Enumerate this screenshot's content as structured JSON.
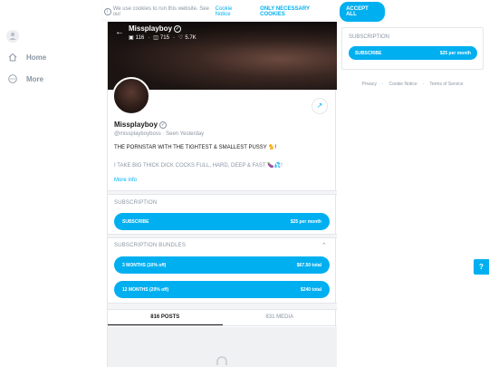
{
  "cookie": {
    "text": "We use cookies to run this website. See our",
    "link": "Cookie Notice",
    "necessary_label": "ONLY NECESSARY COOKIES",
    "accept_label": "ACCEPT ALL"
  },
  "nav": {
    "items": [
      {
        "label": "Home",
        "icon": "home-icon"
      },
      {
        "label": "More",
        "icon": "more-icon"
      }
    ]
  },
  "cover": {
    "name": "Missplayboy",
    "stats": {
      "images": "116",
      "videos": "715",
      "likes": "5.7K"
    }
  },
  "profile": {
    "name": "Missplayboy",
    "handle": "@missplayboyboss",
    "seen": "Seen Yesterday",
    "bio_line1": "THE PORNSTAR WITH THE TIGHTEST & SMALLEST PUSSY 🐈!",
    "bio_line2": "I TAKE BIG THICK DICK COCKS FULL, HARD, DEEP & FAST 🍆💦!",
    "more_info": "More info"
  },
  "subscription": {
    "title": "SUBSCRIPTION",
    "button_label": "SUBSCRIBE",
    "button_price": "$25 per month"
  },
  "bundles": {
    "title": "SUBSCRIPTION BUNDLES",
    "items": [
      {
        "label": "3 MONTHS (10% off)",
        "price": "$67.50 total"
      },
      {
        "label": "12 MONTHS (20% off)",
        "price": "$240 total"
      }
    ]
  },
  "tabs": [
    {
      "label": "816 POSTS",
      "active": true
    },
    {
      "label": "831 MEDIA",
      "active": false
    }
  ],
  "right": {
    "title": "SUBSCRIPTION",
    "button_label": "SUBSCRIBE",
    "button_price": "$25 per month"
  },
  "footer": [
    "Privacy",
    "Cookie Notice",
    "Terms of Service"
  ],
  "colors": {
    "accent": "#00aff0",
    "muted": "#8a96a3"
  }
}
